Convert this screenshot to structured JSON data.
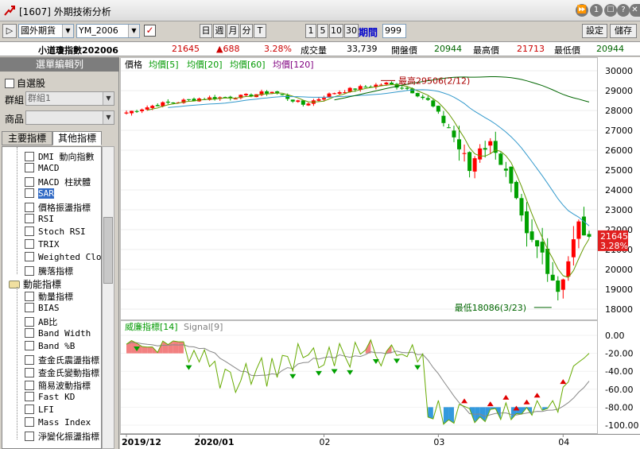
{
  "window": {
    "title": "[1607] 外期技術分析",
    "buttons": [
      "⏩",
      "1",
      "☐",
      "?",
      "✕"
    ]
  },
  "toolbar": {
    "market": "國外期貨",
    "symbol": "YM_2006",
    "chart_types": [
      "日",
      "週",
      "月",
      "分",
      "T"
    ],
    "minute_options": [
      "1",
      "5",
      "10",
      "30"
    ],
    "period_label": "期間",
    "period_value": "999",
    "settings_label": "設定",
    "save_label": "儲存"
  },
  "quote": {
    "name": "小道瓊指數202006",
    "last": "21645",
    "change": "▲688",
    "change_pct": "3.28%",
    "volume_label": "成交量",
    "volume": "33,739",
    "open_label": "開盤價",
    "open": "20944",
    "high_label": "最高價",
    "high": "21713",
    "low_label": "最低價",
    "low": "20944"
  },
  "left_panel": {
    "header": "選單編輯列",
    "watchlist_label": "自選股",
    "group_label": "群組",
    "group_value": "群組1",
    "product_label": "商品",
    "product_value": "",
    "tabs": [
      "主要指標",
      "其他指標"
    ],
    "indicators_top": [
      "DMI 動向指數",
      "MACD",
      "MACD 柱狀體",
      "SAR",
      "價格振盪指標",
      "RSI",
      "Stoch RSI",
      "TRIX",
      "Weighted Clos",
      "騰落指標"
    ],
    "selected_indicator": "SAR",
    "momentum_group": "動能指標",
    "indicators_momentum": [
      "動量指標",
      "BIAS",
      "AB比",
      "Band Width",
      "Band %B",
      "查金氏震盪指標",
      "查金氏變動指標",
      "簡易波動指標",
      "Fast KD",
      "LFI",
      "Mass Index",
      "淨變化振盪指標"
    ]
  },
  "chart": {
    "price_legend": [
      "價格",
      "均價[5]",
      "均價[20]",
      "均價[60]",
      "均價[120]"
    ],
    "price_legend_colors": [
      "#000000",
      "#009900",
      "#009900",
      "#009900",
      "#800080"
    ],
    "price_axis_ticks": [
      "30000",
      "29000",
      "28000",
      "27000",
      "26000",
      "25000",
      "24000",
      "23000",
      "22000",
      "21000",
      "20000",
      "19000",
      "18000"
    ],
    "high_note": "最高29506(2/12)",
    "low_note": "最低18086(3/23)",
    "last_price_tag": "21645",
    "last_pct_tag": "3.28%",
    "ind_legend": [
      "威廉指標[14]",
      "Signal[9]"
    ],
    "ind_legend_colors": [
      "#009900",
      "#808080"
    ],
    "ind_axis_ticks": [
      "0.00",
      "-20.00",
      "-40.00",
      "-60.00",
      "-80.00",
      "-100.00"
    ],
    "date_labels": [
      "2019/12",
      "2020/01",
      "02",
      "03",
      "04"
    ],
    "colors": {
      "up": "#ff0000",
      "down": "#00a000",
      "ma5": "#669900",
      "ma20": "#3399cc",
      "ma60": "#006600",
      "wr": "#66aa00",
      "signal": "#888888",
      "pos_fill": "#f28080",
      "neg_fill": "#3399dd"
    }
  }
}
